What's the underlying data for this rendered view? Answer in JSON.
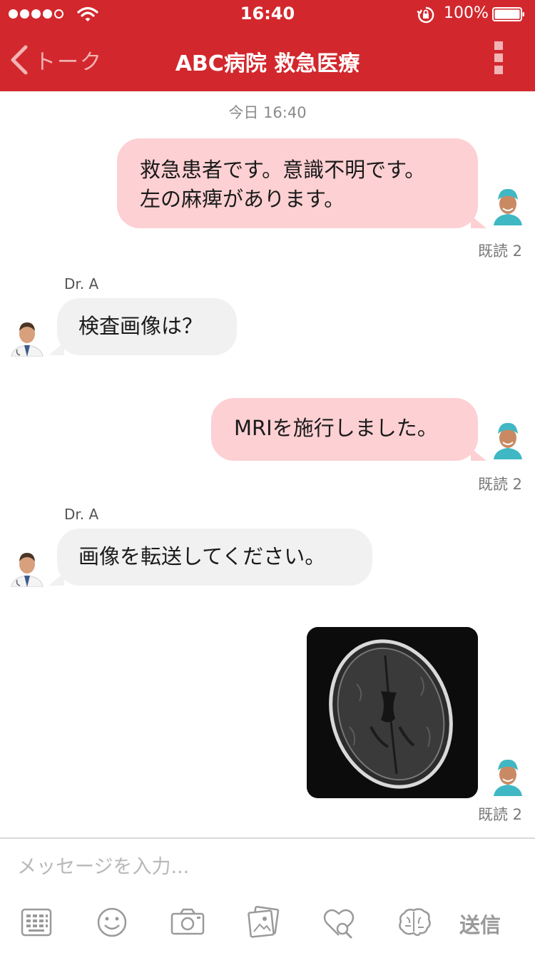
{
  "status_bar": {
    "time": "16:40",
    "battery": "100%"
  },
  "nav": {
    "back_label": "トーク",
    "title": "ABC病院 救急医療"
  },
  "chat": {
    "date": "今日 16:40",
    "messages": [
      {
        "text": "救急患者です。意識不明です。\n左の麻痺があります。",
        "read": "既読 2"
      },
      {
        "sender": "Dr. A",
        "text": "検査画像は？"
      },
      {
        "text": "MRIを施行しました。",
        "read": "既読 2"
      },
      {
        "sender": "Dr. A",
        "text": "画像を転送してください。"
      },
      {
        "read": "既読 2"
      }
    ]
  },
  "input": {
    "placeholder": "メッセージを入力..."
  },
  "toolbar": {
    "icons": [
      "keyboard-icon",
      "emoji-icon",
      "camera-icon",
      "gallery-icon",
      "heart-search-icon",
      "brain-icon"
    ],
    "send_label": "送信"
  },
  "colors": {
    "brand": "#d2282d",
    "outgoing_bubble": "#fdd0d3",
    "incoming_bubble": "#f1f1f1"
  }
}
